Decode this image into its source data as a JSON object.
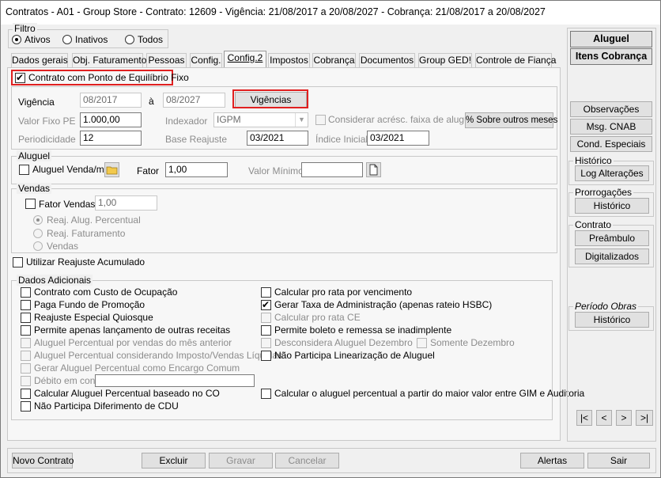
{
  "title": "Contratos - A01 - Group Store - Contrato: 12609 - Vigência: 21/08/2017 a 20/08/2027 - Cobrança: 21/08/2017 a 20/08/2027",
  "filtro": {
    "title": "Filtro",
    "ativos": "Ativos",
    "inativos": "Inativos",
    "todos": "Todos"
  },
  "tabs": [
    "Dados gerais",
    "Obj. Faturamento",
    "Pessoas",
    "Config.",
    "Config.2",
    "Impostos",
    "Cobrança",
    "Documentos",
    "Group GED!",
    "Controle de Fiança"
  ],
  "pe": {
    "checkbox": "Contrato com Ponto de Equilíbrio Fixo",
    "vigencia_label": "Vigência",
    "vigencia_from": "08/2017",
    "vigencia_a": "à",
    "vigencia_to": "08/2027",
    "vigencias_btn": "Vigências",
    "valor_fixo_label": "Valor Fixo PE",
    "valor_fixo": "1.000,00",
    "indexador_label": "Indexador",
    "indexador": "IGPM",
    "considerar": "Considerar acrésc. faixa de aluguel",
    "sobre_btn": "% Sobre outros meses",
    "periodicidade_label": "Periodicidade",
    "periodicidade": "12",
    "base_label": "Base Reajuste",
    "base": "03/2021",
    "indice_label": "Índice Inicial",
    "indice": "03/2021"
  },
  "aluguel": {
    "title": "Aluguel",
    "venda": "Aluguel Venda/m²",
    "fator_label": "Fator",
    "fator": "1,00",
    "valor_min_label": "Valor Mínimo",
    "valor_min": ""
  },
  "vendas": {
    "title": "Vendas",
    "fator_vendas": "Fator Vendas",
    "fator_value": "1,00",
    "reaj_alug": "Reaj. Alug. Percentual",
    "reaj_fat": "Reaj. Faturamento",
    "vendas": "Vendas"
  },
  "utilizar": "Utilizar Reajuste Acumulado",
  "dados": {
    "title": "Dados Adicionais",
    "left": [
      "Contrato com Custo de Ocupação",
      "Paga Fundo de Promoção",
      "Reajuste Especial Quiosque",
      "Permite apenas lançamento de outras receitas",
      "Aluguel Percentual por vendas do mês anterior",
      "Aluguel Percentual considerando Imposto/Vendas Líquidas",
      "Gerar Aluguel Percentual como Encargo Comum",
      "Débito em conta",
      "Calcular Aluguel Percentual baseado no CO",
      "Não Participa Diferimento de CDU"
    ],
    "right": [
      "Calcular pro rata por vencimento",
      "Gerar Taxa de Administração (apenas rateio HSBC)",
      "Calcular pro rata CE",
      "Permite boleto e remessa se inadimplente",
      "Desconsidera Aluguel Dezembro",
      "Não Participa Linearização de Aluguel"
    ],
    "somente": "Somente Dezembro",
    "calcular_maior": "Calcular o aluguel percentual a partir do maior valor entre GIM e Auditoria"
  },
  "side": {
    "aluguel": "Aluguel",
    "itens": "Itens Cobrança",
    "observacoes": "Observações",
    "msg": "Msg. CNAB",
    "cond": "Cond. Especiais",
    "historico_title": "Histórico",
    "log": "Log Alterações",
    "prorrogacoes_title": "Prorrogações",
    "historico_btn": "Histórico",
    "contrato_title": "Contrato",
    "preambulo": "Preâmbulo",
    "digitalizados": "Digitalizados",
    "periodo_title": "Período Obras",
    "periodo_historico": "Histórico"
  },
  "nav": [
    "|<",
    "<",
    ">",
    ">|"
  ],
  "bottom": {
    "novo": "Novo Contrato",
    "excluir": "Excluir",
    "gravar": "Gravar",
    "cancelar": "Cancelar",
    "alertas": "Alertas",
    "sair": "Sair"
  }
}
